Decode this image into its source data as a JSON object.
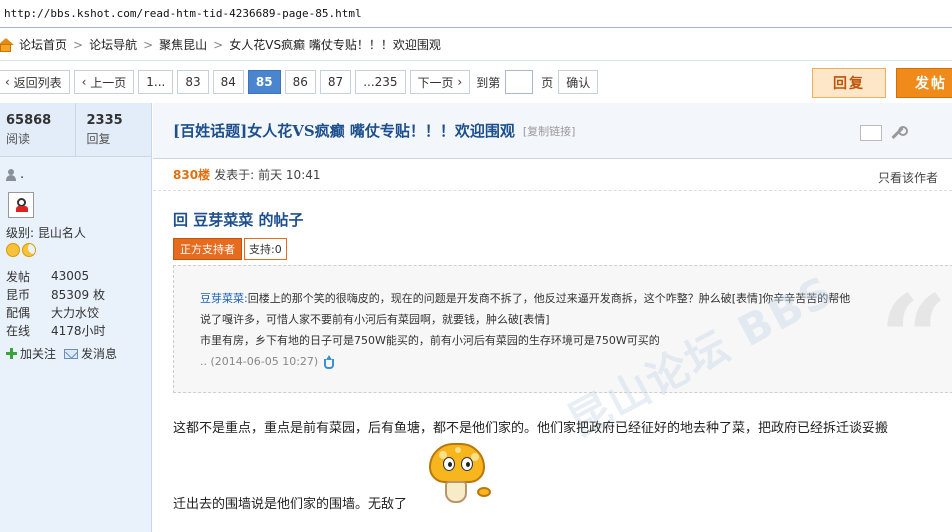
{
  "browser": {
    "url": "http://bbs.kshot.com/read-htm-tid-4236689-page-85.html"
  },
  "breadcrumb": [
    "论坛首页",
    "论坛导航",
    "聚焦昆山",
    "女人花VS疯癫 嘴仗专贴！！！欢迎围观"
  ],
  "pager": {
    "back": "返回列表",
    "prev": "上一页",
    "pages": [
      "1...",
      "83",
      "84",
      "85",
      "86",
      "87",
      "...235"
    ],
    "current": "85",
    "next": "下一页",
    "goto_label": "到第",
    "goto_unit": "页",
    "confirm": "确认"
  },
  "buttons": {
    "reply": "回复",
    "post": "发帖"
  },
  "stats": {
    "reads": "65868",
    "reads_label": "阅读",
    "replies": "2335",
    "replies_label": "回复"
  },
  "user": {
    "name": ".",
    "rank_label": "级别:",
    "rank": "昆山名人",
    "posts_label": "发帖",
    "posts": "43005",
    "coins_label": "昆币",
    "coins": "85309 枚",
    "equip_label": "配偶",
    "equip": "大力水饺",
    "online_label": "在线",
    "online": "4178小时",
    "follow": "加关注",
    "message": "发消息"
  },
  "thread": {
    "title": "[百姓话题]女人花VS疯癫 嘴仗专贴！！！欢迎围观",
    "copy_link": "[复制链接]"
  },
  "post": {
    "floor": "830楼",
    "posted_label": "发表于:",
    "time": "前天  10:41",
    "only_author": "只看该作者",
    "reply_title": "回  豆芽菜菜  的帖子",
    "tag_support": "正方支持者",
    "tag_count": "支持:0",
    "quote_name": "豆芽菜菜:",
    "quote_line1": "回楼上的那个笑的很嗨皮的，现在的问题是开发商不拆了，他反过来逼开发商拆，这个咋整？肿么破[表情]你辛辛苦苦的帮他",
    "quote_line2": "说了嘎许多，可惜人家不要前有小河后有菜园啊，就要钱，肿么破[表情]",
    "quote_line3": "市里有房，乡下有地的日子可是750W能买的，前有小河后有菜园的生存环境可是750W可买的",
    "quote_date": ".. (2014-06-05 10:27)",
    "body_line1": "这都不是重点，重点是前有菜园，后有鱼塘，都不是他们家的。他们家把政府已经征好的地去种了菜，把政府已经拆迁谈妥搬",
    "body_line2": "迁出去的围墙说是他们家的围墙。无敌了"
  },
  "colors": {
    "accent": "#4a86cf",
    "title": "#1d4f8c",
    "post_button": "#f08a1b",
    "floor": "#e0700f"
  }
}
